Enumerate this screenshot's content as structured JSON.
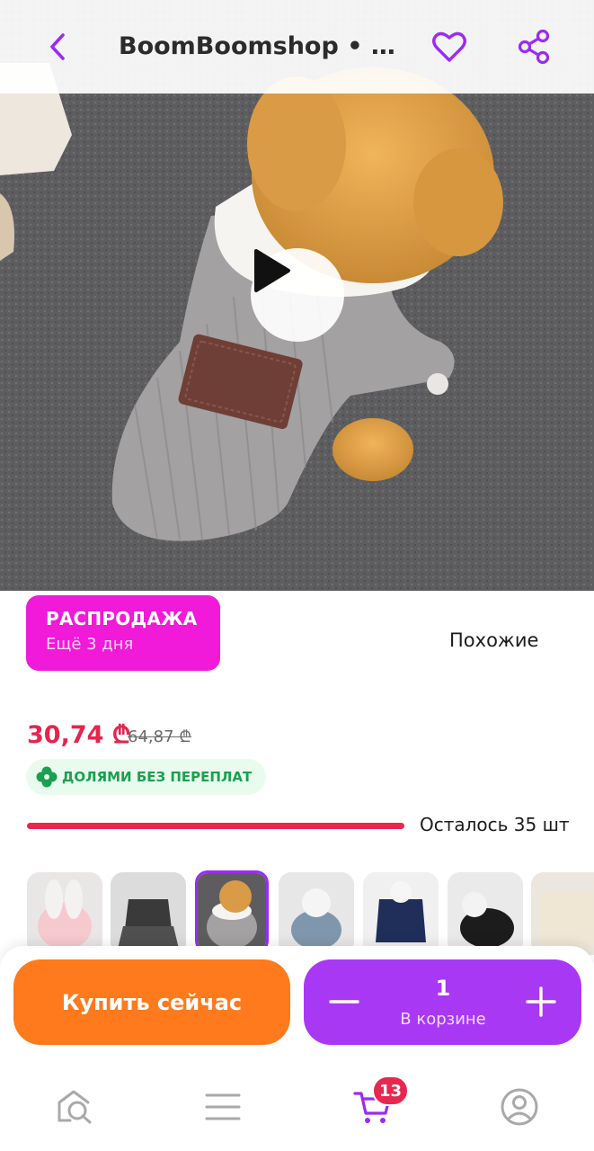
{
  "header": {
    "title": "BoomBoomshop • Куртка для собак",
    "back_icon": "chevron-left-icon",
    "favorite_icon": "heart-icon",
    "share_icon": "share-icon",
    "accent_color": "#9b2cf2"
  },
  "media": {
    "play_icon": "play-icon",
    "image_alt": "dog-in-gray-corduroy-jacket"
  },
  "sale": {
    "label": "РАСПРОДАЖА",
    "remaining": "Ещё 3 дня",
    "color": "#f01ad8"
  },
  "similar_label": "Похожие",
  "price": {
    "current": "30,74 ₾",
    "old": "64,87 ₾",
    "color": "#e4254d"
  },
  "installment": {
    "label": "ДОЛЯМИ БЕЗ ПЕРЕПЛАТ",
    "icon": "clover-icon",
    "color": "#1ba050"
  },
  "stock": {
    "label": "Осталось 35 шт",
    "bar_color": "#e8274f"
  },
  "thumbnails": [
    {
      "name": "pink-bunny-costume"
    },
    {
      "name": "black-tutu-dress"
    },
    {
      "name": "gray-corduroy-jacket",
      "selected": true
    },
    {
      "name": "denim-jacket"
    },
    {
      "name": "navy-hoodie"
    },
    {
      "name": "black-sweatshirt"
    },
    {
      "name": "beige-sweater"
    }
  ],
  "actions": {
    "buy_label": "Купить сейчас",
    "buy_color": "#fe7a1c",
    "quantity": "1",
    "in_cart_label": "В корзине",
    "cart_color": "#a938f5"
  },
  "tabbar": {
    "items": [
      {
        "icon": "home-search-icon"
      },
      {
        "icon": "menu-icon"
      },
      {
        "icon": "cart-icon",
        "active": true
      },
      {
        "icon": "profile-icon"
      }
    ],
    "cart_badge": "13"
  }
}
